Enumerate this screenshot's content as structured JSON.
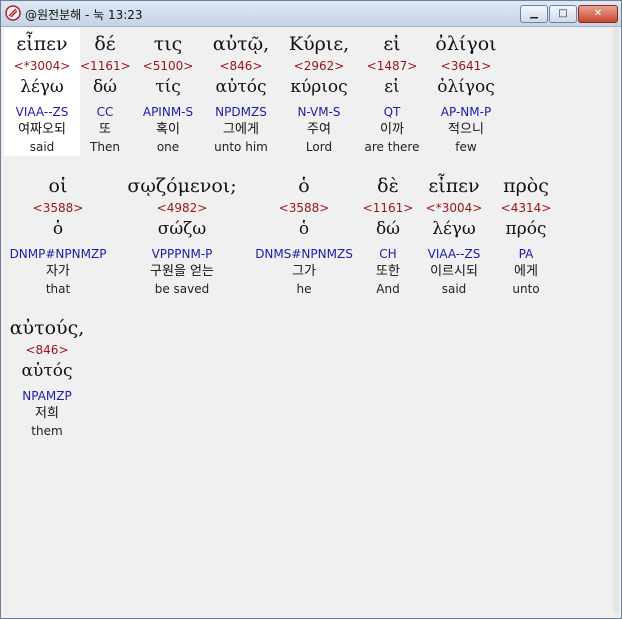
{
  "window": {
    "title": "@원전분해 - 눅 13:23",
    "minimize_label": "▁",
    "maximize_label": "□",
    "close_label": "✕"
  },
  "words": [
    {
      "greek": "εἶπεν",
      "strong": "<*3004>",
      "lemma": "λέγω",
      "morph": "VIAA--ZS",
      "korean": "여짜오되",
      "english": "said",
      "selected": true
    },
    {
      "greek": "δέ",
      "strong": "<1161>",
      "lemma": "δώ",
      "morph": "CC",
      "korean": "또",
      "english": "Then"
    },
    {
      "greek": "τις",
      "strong": "<5100>",
      "lemma": "τίς",
      "morph": "APINM-S",
      "korean": "혹이",
      "english": "one"
    },
    {
      "greek": "αὐτῷ,",
      "strong": "<846>",
      "lemma": "αὐτός",
      "morph": "NPDMZS",
      "korean": "그에게",
      "english": "unto him"
    },
    {
      "greek": "Κύριε,",
      "strong": "<2962>",
      "lemma": "κύριος",
      "morph": "N-VM-S",
      "korean": "주여",
      "english": "Lord"
    },
    {
      "greek": "εἰ",
      "strong": "<1487>",
      "lemma": "εἰ",
      "morph": "QT",
      "korean": "이까",
      "english": "are there"
    },
    {
      "greek": "ὀλίγοι",
      "strong": "<3641>",
      "lemma": "ὀλίγος",
      "morph": "AP-NM-P",
      "korean": "적으니",
      "english": "few"
    },
    {
      "greek": "οἱ",
      "strong": "<3588>",
      "lemma": "ὁ",
      "morph": "DNMP#NPNMZP",
      "korean": "자가",
      "english": "that"
    },
    {
      "greek": "σῳζόμενοι;",
      "strong": "<4982>",
      "lemma": "σώζω",
      "morph": "VPPPNM-P",
      "korean": "구원을 얻는",
      "english": "be saved"
    },
    {
      "greek": "ὁ",
      "strong": "<3588>",
      "lemma": "ὁ",
      "morph": "DNMS#NPNMZS",
      "korean": "그가",
      "english": "he"
    },
    {
      "greek": "δὲ",
      "strong": "<1161>",
      "lemma": "δώ",
      "morph": "CH",
      "korean": "또한",
      "english": "And"
    },
    {
      "greek": "εἶπεν",
      "strong": "<*3004>",
      "lemma": "λέγω",
      "morph": "VIAA--ZS",
      "korean": "이르시되",
      "english": "said"
    },
    {
      "greek": "πρὸς",
      "strong": "<4314>",
      "lemma": "πρός",
      "morph": "PA",
      "korean": "에게",
      "english": "unto"
    },
    {
      "greek": "αὐτούς,",
      "strong": "<846>",
      "lemma": "αὐτός",
      "morph": "NPAMZP",
      "korean": "저희",
      "english": "them"
    }
  ]
}
